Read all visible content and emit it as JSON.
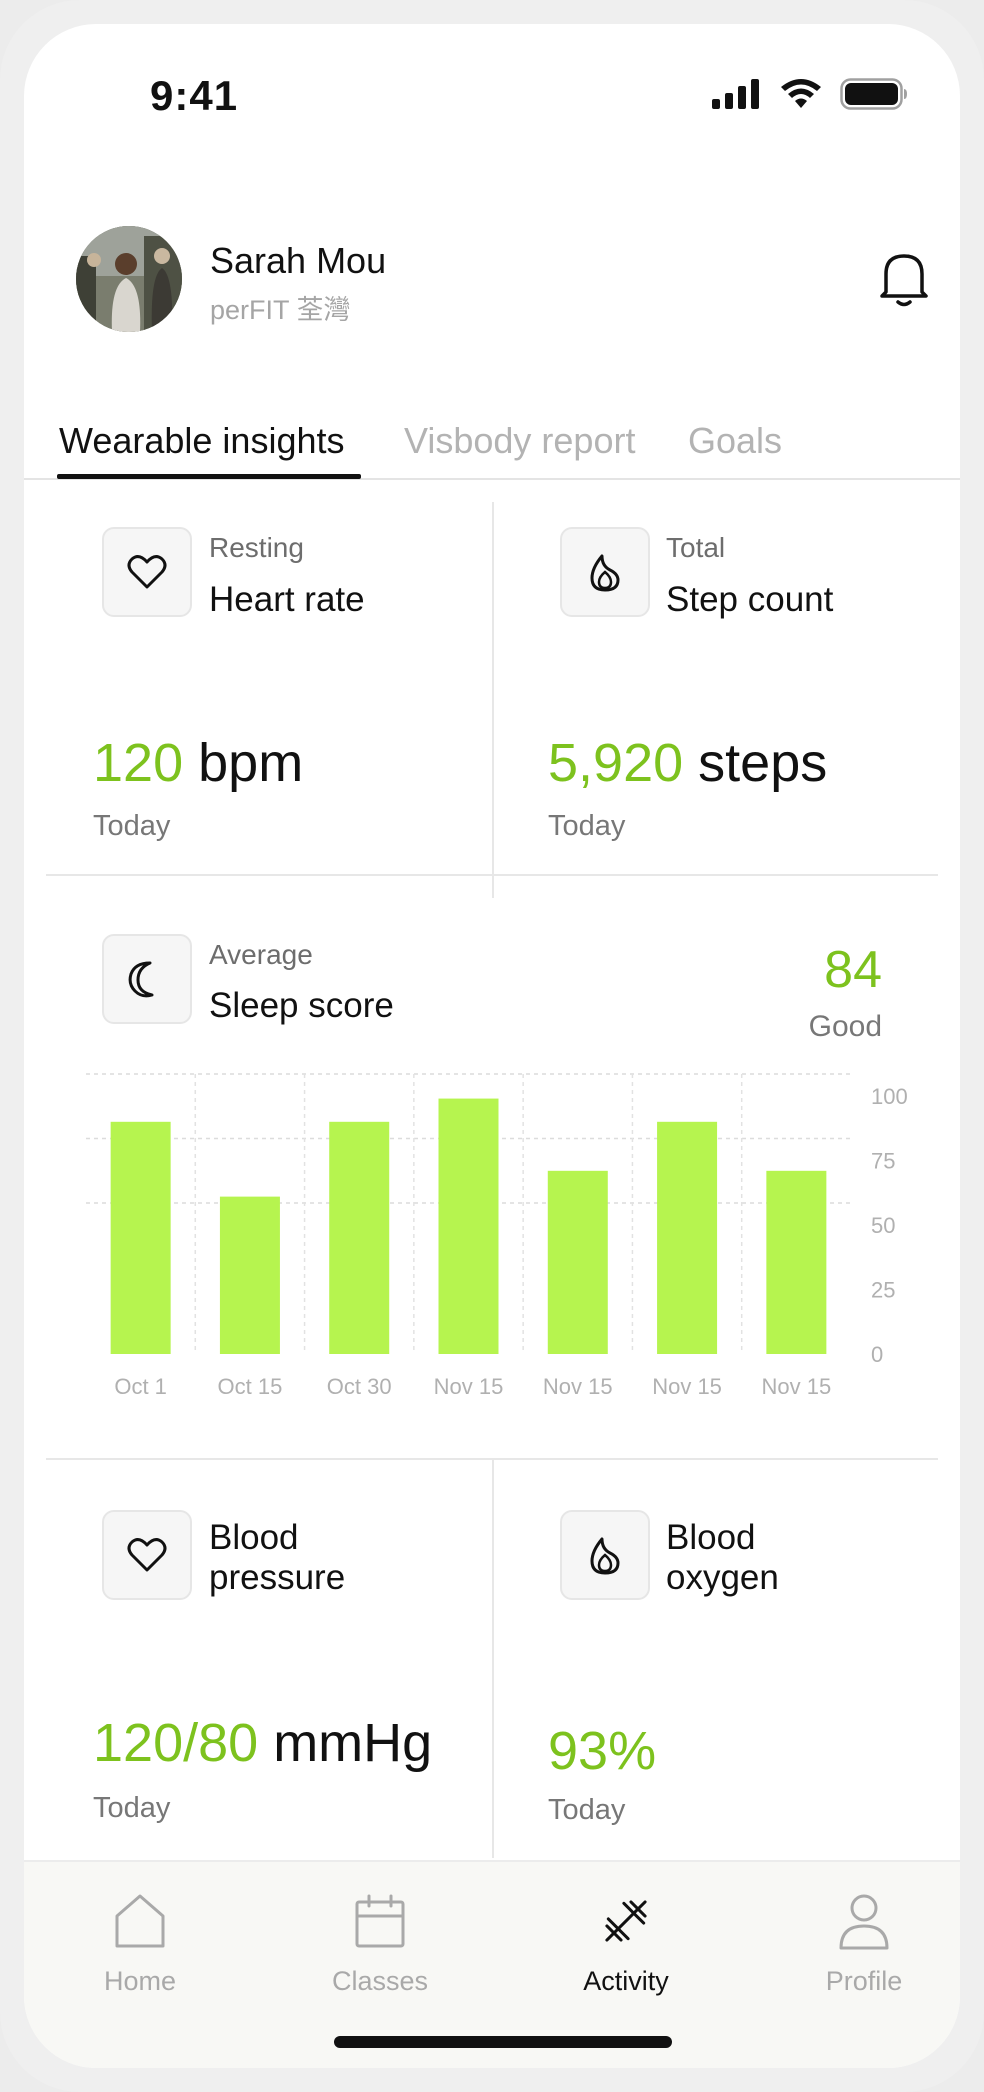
{
  "status_bar": {
    "time": "9:41"
  },
  "user": {
    "name": "Sarah Mou",
    "subtitle": "perFIT 荃灣"
  },
  "tabs": [
    {
      "label": "Wearable insights",
      "active": true
    },
    {
      "label": "Visbody report",
      "active": false
    },
    {
      "label": "Goals",
      "active": false
    }
  ],
  "cards": {
    "heart_rate": {
      "kicker": "Resting",
      "title": "Heart rate",
      "value": "120",
      "unit": "bpm",
      "period": "Today",
      "icon": "heart-icon"
    },
    "steps": {
      "kicker": "Total",
      "title": "Step count",
      "value": "5,920",
      "unit": "steps",
      "period": "Today",
      "icon": "flame-icon"
    },
    "sleep": {
      "kicker": "Average",
      "title": "Sleep score",
      "score": "84",
      "rating": "Good",
      "icon": "moon-icon"
    },
    "blood_pressure": {
      "title_line1": "Blood",
      "title_line2": "pressure",
      "value": "120/80",
      "unit": "mmHg",
      "period": "Today",
      "icon": "heart-icon"
    },
    "blood_oxygen": {
      "title_line1": "Blood",
      "title_line2": "oxygen",
      "value": "93%",
      "period": "Today",
      "icon": "flame-icon"
    }
  },
  "chart_data": {
    "type": "bar",
    "categories": [
      "Oct 1",
      "Oct 15",
      "Oct 30",
      "Nov 15",
      "Nov 15",
      "Nov 15",
      "Nov 15"
    ],
    "values": [
      90,
      61,
      90,
      99,
      71,
      90,
      71
    ],
    "ylim": [
      0,
      100
    ],
    "yticks": [
      0,
      25,
      50,
      75,
      100
    ],
    "grid": true,
    "bar_color": "#b6f44f"
  },
  "nav": [
    {
      "label": "Home",
      "icon": "home-icon",
      "active": false
    },
    {
      "label": "Classes",
      "icon": "calendar-icon",
      "active": false
    },
    {
      "label": "Activity",
      "icon": "dumbbell-icon",
      "active": true
    },
    {
      "label": "Profile",
      "icon": "person-icon",
      "active": false
    }
  ],
  "colors": {
    "accent": "#7dc21e",
    "bar": "#b6f44f",
    "text": "#111111",
    "muted": "#a9a9a9"
  }
}
